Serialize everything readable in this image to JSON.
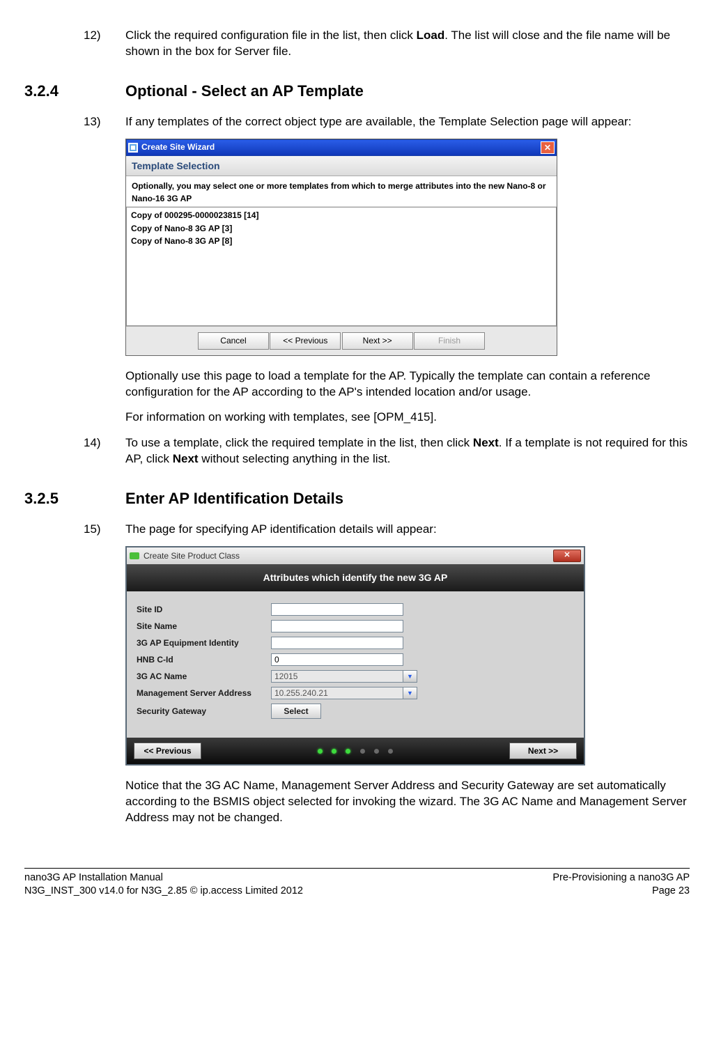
{
  "step12": {
    "num": "12)",
    "text_a": "Click the required configuration file in the list, then click ",
    "bold": "Load",
    "text_b": ". The list will close and the file name will be shown in the box for Server file."
  },
  "section324": {
    "num": "3.2.4",
    "title": "Optional - Select an AP Template"
  },
  "step13": {
    "num": "13)",
    "text": "If any templates of the correct object type are available, the Template Selection page will appear:"
  },
  "wizard1": {
    "title": "Create Site Wizard",
    "subhead": "Template Selection",
    "instr": "Optionally, you may select one or more templates from which to merge attributes into the new Nano-8 or Nano-16 3G AP",
    "rows": [
      "Copy of 000295-0000023815 [14]",
      "Copy of Nano-8 3G AP [3]",
      "Copy of Nano-8 3G AP [8]"
    ],
    "btn_cancel": "Cancel",
    "btn_prev": "<< Previous",
    "btn_next": "Next >>",
    "btn_finish": "Finish"
  },
  "post13a": "Optionally use this page to load a template for the AP. Typically the template can contain a reference configuration for the AP according to the AP's intended location and/or usage.",
  "post13b": "For information on working with templates, see [OPM_415].",
  "step14": {
    "num": "14)",
    "a": "To use a template, click the required template in the list, then click ",
    "b1": "Next",
    "c": ". If a template is not required for this AP, click ",
    "b2": "Next",
    "d": " without selecting anything in the list."
  },
  "section325": {
    "num": "3.2.5",
    "title": "Enter AP Identification Details"
  },
  "step15": {
    "num": "15)",
    "text": "The page for specifying AP identification details will appear:"
  },
  "wizard2": {
    "title": "Create Site Product Class",
    "header": "Attributes which identify the new 3G AP",
    "fields": {
      "site_id": {
        "label": "Site ID",
        "value": ""
      },
      "site_name": {
        "label": "Site Name",
        "value": ""
      },
      "equip": {
        "label": "3G AP Equipment Identity",
        "value": ""
      },
      "hnb": {
        "label": "HNB C-Id",
        "value": "0"
      },
      "ac_name": {
        "label": "3G AC Name",
        "value": "12015"
      },
      "mgmt": {
        "label": "Management Server Address",
        "value": "10.255.240.21"
      },
      "secgw": {
        "label": "Security Gateway",
        "button": "Select"
      }
    },
    "btn_prev": "<< Previous",
    "btn_next": "Next >>"
  },
  "post15": "Notice that the 3G AC Name, Management Server Address and Security Gateway are set automatically according to the BSMIS object selected for invoking the wizard. The 3G AC Name and Management Server Address may not be changed.",
  "footer": {
    "l1": "nano3G AP Installation Manual",
    "l2": "N3G_INST_300 v14.0 for N3G_2.85 © ip.access Limited 2012",
    "r1": "Pre-Provisioning a nano3G AP",
    "r2": "Page 23"
  }
}
